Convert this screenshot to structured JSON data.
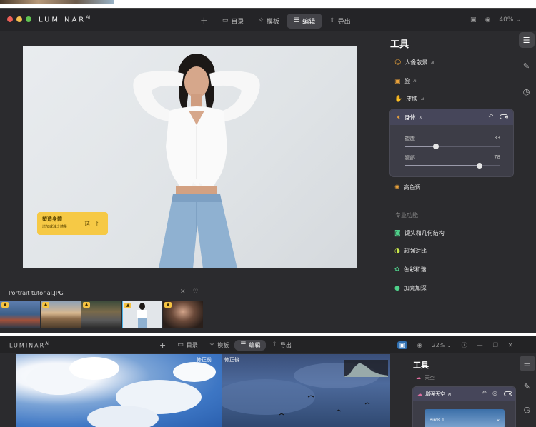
{
  "window1": {
    "app_name": "LUMINAR",
    "app_name_sup": "AI",
    "nav": {
      "add_label": "+",
      "catalog_label": "目录",
      "templates_label": "模板",
      "edit_label": "编辑",
      "export_label": "导出"
    },
    "zoom": "40%",
    "file_name": "Portrait tutorial.JPG",
    "hint": {
      "title": "塑造身體",
      "subtitle": "增加或減少體量",
      "action": "試一下"
    },
    "panel": {
      "title": "工具",
      "tools": [
        {
          "label": "人像散景",
          "badge": "AI",
          "icon": "portrait-bokeh-icon",
          "color": "#e9a23b"
        },
        {
          "label": "脸",
          "badge": "AI",
          "icon": "face-icon",
          "color": "#e9a23b"
        },
        {
          "label": "皮肤",
          "badge": "AI",
          "icon": "skin-icon",
          "color": "#e9a23b"
        }
      ],
      "body_tool": {
        "label": "身体",
        "badge": "AI",
        "sliders": [
          {
            "label": "塑造",
            "value": 33
          },
          {
            "label": "腹部",
            "value": 78
          }
        ]
      },
      "highkey_label": "高色调",
      "pro_title": "专业功能",
      "pro_tools": [
        {
          "label": "镜头和几何结构",
          "icon": "camera-icon",
          "color": "#4fd08a"
        },
        {
          "label": "超强对比",
          "icon": "contrast-icon",
          "color": "#c9e84a"
        },
        {
          "label": "色彩和谐",
          "icon": "color-harmony-icon",
          "color": "#4fd08a"
        },
        {
          "label": "加亮加深",
          "icon": "dodge-burn-icon",
          "color": "#4fd08a"
        }
      ]
    }
  },
  "window2": {
    "app_name": "LUMINAR",
    "app_name_sup": "AI",
    "nav": {
      "add_label": "+",
      "catalog_label": "目录",
      "templates_label": "模板",
      "edit_label": "编辑",
      "export_label": "导出"
    },
    "zoom": "22%",
    "before_label": "修正前",
    "after_label": "修正後",
    "panel": {
      "title": "工具",
      "sky_label": "天空",
      "enhanced_sky_label": "增强天空",
      "enhanced_sky_badge": "AI",
      "birds_label": "Birds 1"
    }
  },
  "colors": {
    "window_bg": "#2b2b2e",
    "titlebar_bg": "#242427",
    "accent_yellow": "#f6c945",
    "selection_blue": "#4db3e6"
  }
}
